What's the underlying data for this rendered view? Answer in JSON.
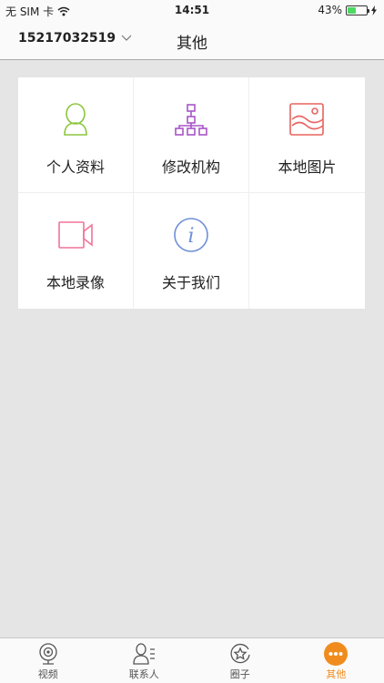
{
  "status_bar": {
    "carrier": "无 SIM 卡",
    "time": "14:51",
    "battery_percent": "43%",
    "battery_level": 0.43
  },
  "nav": {
    "account": "15217032519",
    "title": "其他"
  },
  "grid": {
    "items": [
      {
        "label": "个人资料",
        "icon": "person-icon",
        "color": "#8cc63f"
      },
      {
        "label": "修改机构",
        "icon": "org-chart-icon",
        "color": "#a855c8"
      },
      {
        "label": "本地图片",
        "icon": "picture-icon",
        "color": "#e8635f"
      },
      {
        "label": "本地录像",
        "icon": "video-camera-icon",
        "color": "#f0739a"
      },
      {
        "label": "关于我们",
        "icon": "info-icon",
        "color": "#6f8fd8"
      }
    ]
  },
  "tab_bar": {
    "tabs": [
      {
        "label": "视频",
        "icon": "webcam-icon"
      },
      {
        "label": "联系人",
        "icon": "contacts-icon"
      },
      {
        "label": "圈子",
        "icon": "star-circle-icon"
      },
      {
        "label": "其他",
        "icon": "more-dots-icon",
        "active": true
      }
    ],
    "accent_color": "#f08c1e"
  }
}
